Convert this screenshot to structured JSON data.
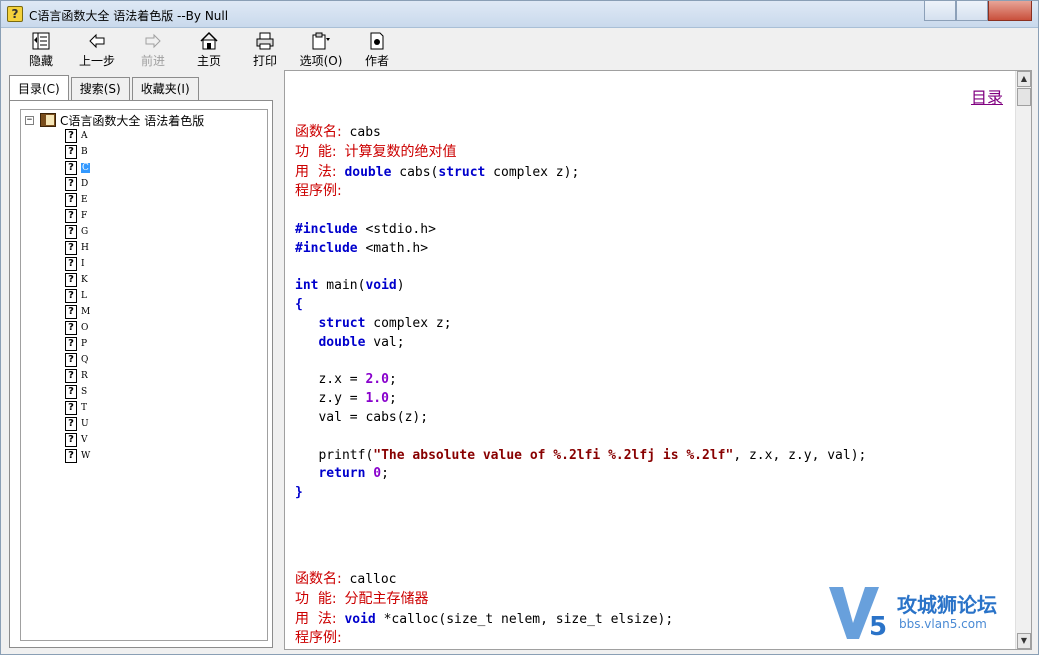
{
  "window": {
    "title": "C语言函数大全 语法着色版 --By Null"
  },
  "toolbar": {
    "buttons": [
      {
        "label": "隐藏",
        "icon": "hide-icon",
        "enabled": true
      },
      {
        "label": "上一步",
        "icon": "back-arrow-icon",
        "enabled": true
      },
      {
        "label": "前进",
        "icon": "forward-arrow-icon",
        "enabled": false
      },
      {
        "label": "主页",
        "icon": "home-icon",
        "enabled": true
      },
      {
        "label": "打印",
        "icon": "printer-icon",
        "enabled": true
      },
      {
        "label": "选项(O)",
        "icon": "options-icon",
        "enabled": true
      },
      {
        "label": "作者",
        "icon": "author-document-icon",
        "enabled": true
      }
    ]
  },
  "tabs": [
    {
      "label": "目录(C)",
      "active": true
    },
    {
      "label": "搜索(S)",
      "active": false
    },
    {
      "label": "收藏夹(I)",
      "active": false
    }
  ],
  "tree": {
    "root_label": "C语言函数大全 语法着色版",
    "items": [
      "A",
      "B",
      "C",
      "D",
      "E",
      "F",
      "G",
      "H",
      "I",
      "K",
      "L",
      "M",
      "O",
      "P",
      "Q",
      "R",
      "S",
      "T",
      "U",
      "V",
      "W"
    ],
    "selected": "C"
  },
  "content": {
    "toc_link": "目录",
    "entry1": {
      "name_label": "函数名:",
      "name": "cabs",
      "func_label": "功  能:",
      "func": "计算复数的绝对值",
      "usage_label": "用  法:",
      "example_label": "程序例:"
    },
    "entry2": {
      "name_label": "函数名:",
      "name": "calloc",
      "func_label": "功  能:",
      "func": "分配主存储器",
      "usage_label": "用  法:",
      "example_label": "程序例:"
    }
  },
  "watermark": {
    "title": "攻城狮论坛",
    "url": "bbs.vlan5.com"
  },
  "colors": {
    "chinese_label": "#cc0000",
    "keyword": "#0000cc",
    "number": "#8800cc",
    "string": "#880000",
    "link_visited": "#800080",
    "selection": "#3399ff"
  }
}
